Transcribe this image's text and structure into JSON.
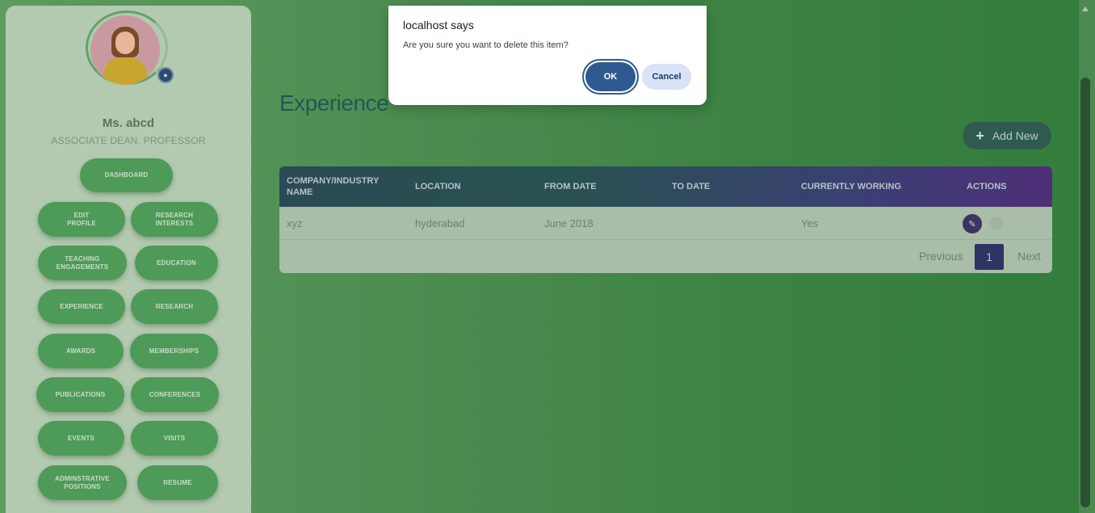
{
  "user": {
    "name": "Ms. abcd",
    "role": "ASSOCIATE DEAN. PROFESSOR"
  },
  "sidebar": {
    "dashboard": "DASHBOARD",
    "items": [
      {
        "label": "EDIT\nPROFILE"
      },
      {
        "label": "RESEARCH\nINTERESTS"
      },
      {
        "label": "TEACHING\nENGAGEMENTS"
      },
      {
        "label": "EDUCATION"
      },
      {
        "label": "EXPERIENCE"
      },
      {
        "label": "RESEARCH"
      },
      {
        "label": "AWARDS"
      },
      {
        "label": "MEMBERSHIPS"
      },
      {
        "label": "PUBLICATIONS"
      },
      {
        "label": "CONFERENCES"
      },
      {
        "label": "EVENTS"
      },
      {
        "label": "VISITS"
      },
      {
        "label": "ADMINSTRATIVE\nPOSITIONS"
      },
      {
        "label": "RESUME"
      }
    ]
  },
  "main": {
    "title": "Experience",
    "add_new": "Add New",
    "table": {
      "headers": [
        "COMPANY/INDUSTRY NAME",
        "LOCATION",
        "FROM DATE",
        "TO DATE",
        "CURRENTLY WORKING",
        "ACTIONS"
      ],
      "rows": [
        {
          "company": "xyz",
          "location": "hyderabad",
          "from": "June 2018",
          "to": "",
          "current": "Yes"
        }
      ]
    },
    "pagination": {
      "previous": "Previous",
      "page": "1",
      "next": "Next"
    }
  },
  "dialog": {
    "title": "localhost says",
    "message": "Are you sure you want to delete this item?",
    "ok": "OK",
    "cancel": "Cancel"
  },
  "icons": {
    "plus": "plus-icon",
    "edit": "edit-icon",
    "camera": "camera-icon"
  }
}
